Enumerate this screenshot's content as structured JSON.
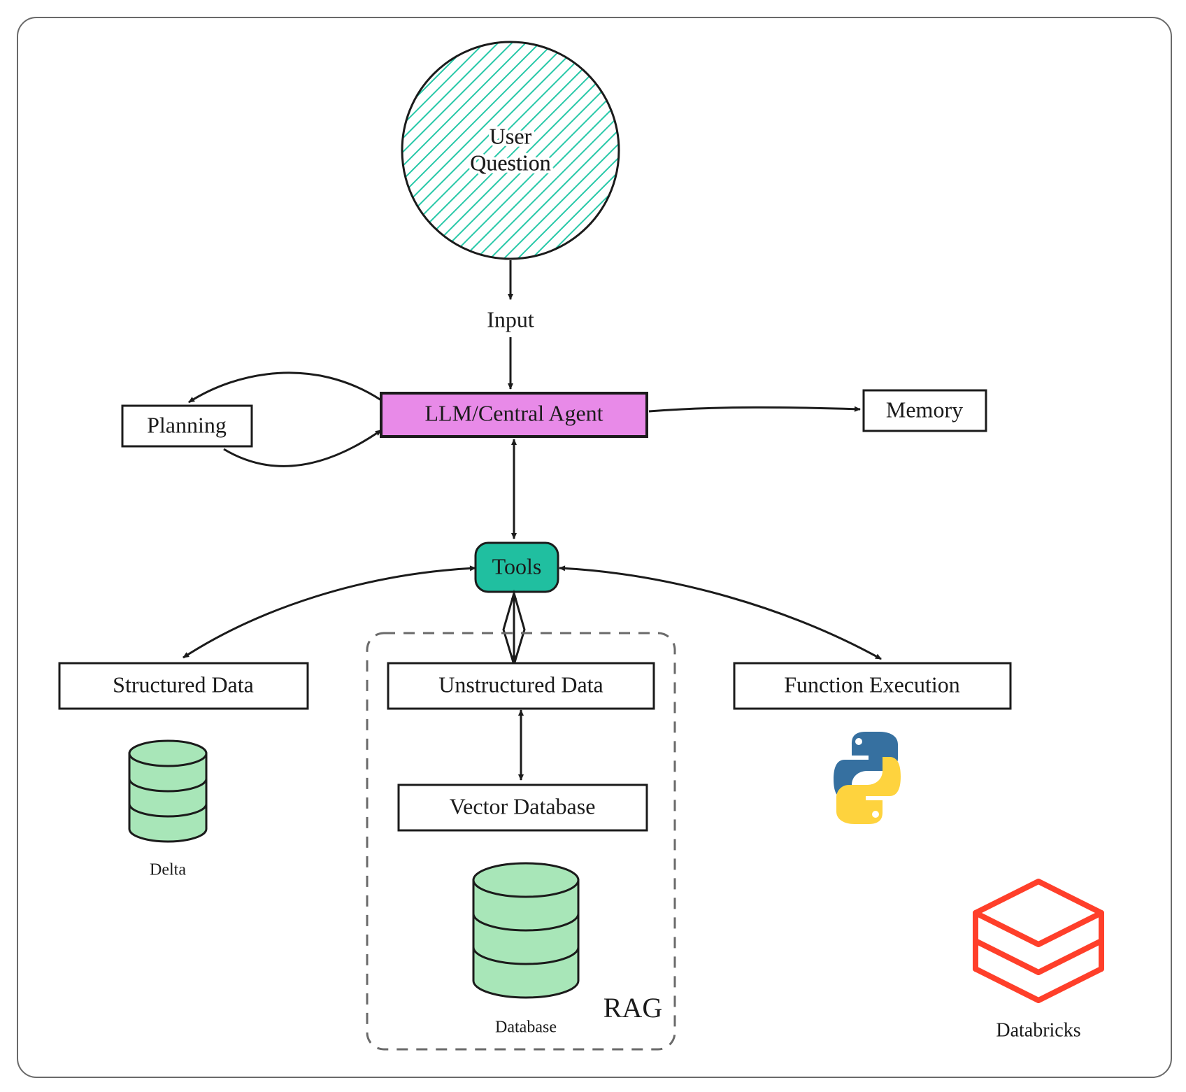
{
  "nodes": {
    "user_question": "User\nQuestion",
    "input_label": "Input",
    "central_agent": "LLM/Central Agent",
    "planning": "Planning",
    "memory": "Memory",
    "tools": "Tools",
    "structured_data": "Structured Data",
    "unstructured_data": "Unstructured Data",
    "function_execution": "Function Execution",
    "vector_database": "Vector Database",
    "rag_label": "RAG",
    "delta_label": "Delta",
    "database_label": "Database",
    "databricks_label": "Databricks"
  },
  "colors": {
    "agent_fill": "#e88ae8",
    "tools_fill": "#20bfa0",
    "circle_hatch": "#28c8a8",
    "db_fill": "#a8e6b8",
    "databricks_red": "#ff3f2a",
    "python_blue": "#3670a0",
    "python_yellow": "#fed33e"
  },
  "icons": {
    "python": "python-logo-icon",
    "databricks": "databricks-logo-icon",
    "database_small": "database-icon",
    "database_large": "database-icon"
  }
}
